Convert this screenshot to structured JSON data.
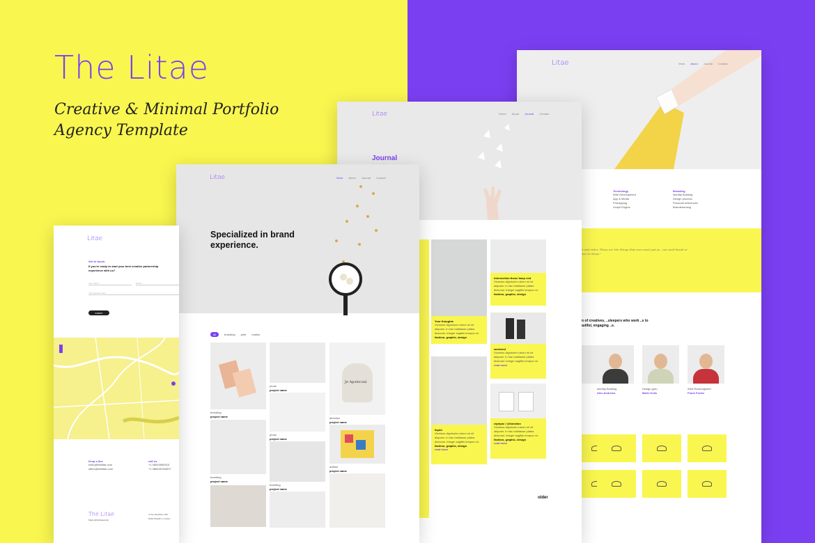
{
  "brand": {
    "name": "The Litae",
    "tagline_line1": "Creative & Minimal Portfolio",
    "tagline_line2": "Agency Template"
  },
  "colors": {
    "yellow": "#f9f64f",
    "purple": "#7b3ff2"
  },
  "mini_logo": "Litae",
  "about_page": {
    "nav": [
      "Work",
      "About",
      "Journal",
      "Contact"
    ],
    "col1_title": "Technology",
    "col1_items": [
      "Web Development",
      "App & Media",
      "Prototyping",
      "Graph Engine"
    ],
    "col2_title": "Branding",
    "col2_items": [
      "Identity Building",
      "Design process",
      "Personal references",
      "Brandstorming"
    ],
    "quote": "..ght and order. These are the things that men need just as ..ow need bread or a place to sleep.\"",
    "team_heading": "..am of creatives, ..sleepers who work ..s to beautiful, engaging ..s.",
    "team": [
      {
        "role": "Identity Building",
        "name": "Alex Andrews"
      },
      {
        "role": "Design guru",
        "name": "Marie Kelis"
      },
      {
        "role": "Web Rockengineer",
        "name": "Frank Fortes"
      }
    ],
    "logo_tiles": [
      "Litae",
      "Litae",
      "Litae",
      "Litae",
      "Litae",
      "Litae",
      "Litae",
      "Litae"
    ]
  },
  "journal_page": {
    "nav": [
      "Home",
      "About",
      "Journal",
      "Contact"
    ],
    "title": "Journal",
    "subtitle": "I just don't know why people",
    "posts": [
      {
        "title": "Your thoughts",
        "meta": "fashion, graphic, design",
        "read": "read more"
      },
      {
        "title": "Intersection those lamp rest",
        "meta": "fashion, graphic, design",
        "read": "read more"
      },
      {
        "title": "weekend",
        "meta": "fashion, graphic, design",
        "read": "read more"
      },
      {
        "title": "liquid",
        "meta": "fashion, graphic, design",
        "read": "read more"
      },
      {
        "title": "olympic / @lionslion",
        "meta": "fashion, graphic, design",
        "read": "read more"
      }
    ],
    "excerpt": "Vivamus dignissim rutrum mi sit aliquam. In hac habitasse platea dictumst. Integer sagittis tempus mi.",
    "older": "older"
  },
  "work_page": {
    "nav": [
      "Work",
      "About",
      "Journal",
      "Contact"
    ],
    "headline": "Specialized in brand experience.",
    "filters": [
      "all",
      "branding",
      "print",
      "motion"
    ],
    "projects": [
      {
        "category": "branding",
        "name": "project name"
      },
      {
        "category": "photo",
        "name": "project name"
      },
      {
        "category": "direction",
        "name": "project name"
      },
      {
        "category": "branding",
        "name": "project name"
      },
      {
        "category": "photo",
        "name": "project name"
      },
      {
        "category": "direction",
        "name": "project name"
      },
      {
        "category": "artifact",
        "name": "project name"
      },
      {
        "category": "branding",
        "name": "project name"
      },
      {
        "category": "photo",
        "name": "project name"
      }
    ],
    "jepoleon": "Je Apoleconi"
  },
  "contact_page": {
    "heading_small": "Get in touch.",
    "heading": "If you're ready to start your best creative partnership experience with us?",
    "name_placeholder": "Your name *",
    "email_placeholder": "Email *",
    "message_placeholder": "Your question here",
    "submit": "SUBMIT",
    "drop_title": "Drop a line",
    "drop_lines": [
      "hello@thelitae.com",
      "office@thelitae.com"
    ],
    "call_title": "call us",
    "call_lines": [
      "+1 08543559310",
      "+1 088439768572"
    ],
    "footer_logo": "The Litae",
    "footer_copy": "Made @thelitaestudio",
    "address": "In the elsewhere 394\nDeltā Kingdom, London"
  }
}
